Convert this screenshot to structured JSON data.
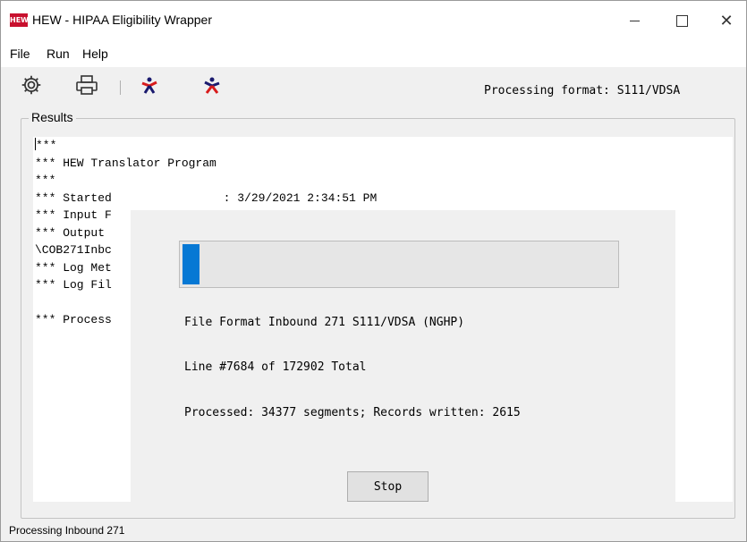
{
  "window": {
    "app_icon_text": "HEW",
    "title": "HEW - HIPAA Eligibility Wrapper",
    "minimize_glyph": "minimize",
    "maximize_glyph": "maximize",
    "close_glyph": "✕"
  },
  "menu": {
    "items": [
      "File",
      "Run",
      "Help"
    ]
  },
  "toolbar": {
    "icons": [
      "gear-icon",
      "printer-icon",
      "run-translator-icon",
      "stop-translator-icon"
    ],
    "processing_format": "Processing format: S111/VDSA"
  },
  "results": {
    "label": "Results",
    "lines": [
      "***",
      "*** HEW Translator Program",
      "***",
      "*** Started                : 3/29/2021 2:34:51 PM",
      "*** Input F",
      "*** Output",
      "\\COB271Inbc",
      "*** Log Met",
      "*** Log Fil",
      "",
      "*** Process"
    ]
  },
  "progress_dialog": {
    "progress": 0.04,
    "file_format": "File Format Inbound 271 S111/VDSA (NGHP)",
    "line_status": "Line #7684 of 172902 Total",
    "processed_status": "Processed: 34377 segments; Records written: 2615",
    "stop_label": "Stop"
  },
  "statusbar": {
    "text": "Processing Inbound 271"
  },
  "colors": {
    "accent": "#0678d4",
    "app_icon_bg": "#c8102e",
    "window_bg": "#f0f0f0"
  }
}
